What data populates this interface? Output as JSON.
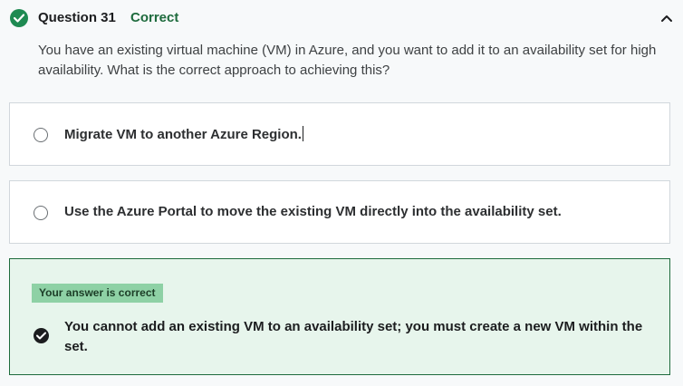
{
  "header": {
    "question_label": "Question 31",
    "status": "Correct",
    "status_icon": "check-circle-icon",
    "collapse_icon": "chevron-up-icon"
  },
  "question": {
    "text": "You have an existing virtual machine (VM) in Azure, and you want to add it to an availability set for high availability. What is the correct approach to achieving this?"
  },
  "options": [
    {
      "text": "Migrate VM to another Azure Region.",
      "selected": false
    },
    {
      "text": "Use the Azure Portal to move the existing VM directly into the availability set.",
      "selected": false
    }
  ],
  "correct_answer": {
    "badge": "Your answer is correct",
    "text": "You cannot add an existing VM to an availability set; you must create a new VM within the set.",
    "selected": true
  },
  "colors": {
    "success": "#1e8a52",
    "success_bg": "#e7f5ec",
    "badge_bg": "#8ed1a5"
  }
}
